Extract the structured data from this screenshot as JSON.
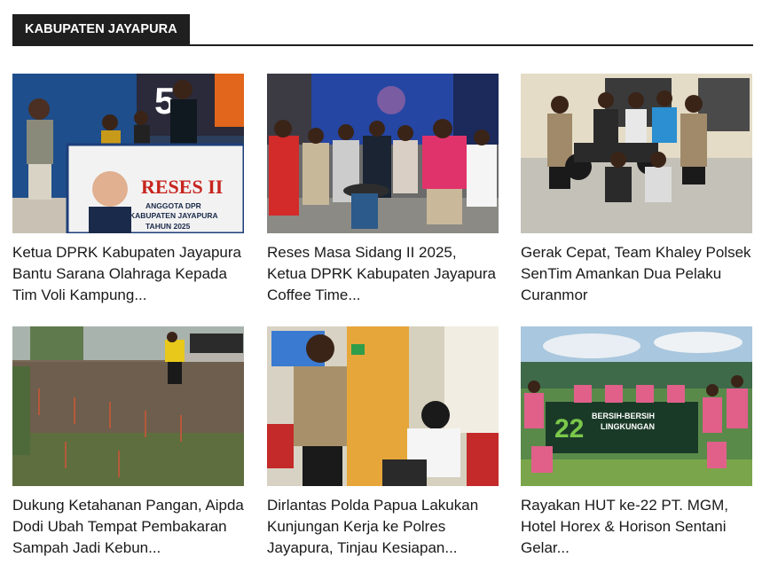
{
  "section": {
    "title": "KABUPATEN JAYAPURA"
  },
  "articles": [
    {
      "title": "Ketua DPRK Kabupaten Jayapura Bantu Sarana Olahraga Kepada Tim Voli Kampung...",
      "banner_text": "RESES II",
      "banner_subtext": "ANGGOTA DPR KABUPATEN JAYAPURA TAHUN 2025"
    },
    {
      "title": "Reses Masa Sidang II 2025, Ketua DPRK Kabupaten Jayapura Coffee Time..."
    },
    {
      "title": "Gerak Cepat, Team Khaley Polsek SenTim Amankan Dua Pelaku Curanmor"
    },
    {
      "title": "Dukung Ketahanan Pangan, Aipda Dodi Ubah Tempat Pembakaran Sampah Jadi Kebun..."
    },
    {
      "title": "Dirlantas Polda Papua Lakukan Kunjungan Kerja ke Polres Jayapura, Tinjau Kesiapan..."
    },
    {
      "title": "Rayakan HUT ke-22 PT. MGM, Hotel Horex & Horison Sentani Gelar...",
      "banner_text": "BERSIH-BERSIH LINGKUNGAN",
      "banner_number": "22"
    }
  ]
}
